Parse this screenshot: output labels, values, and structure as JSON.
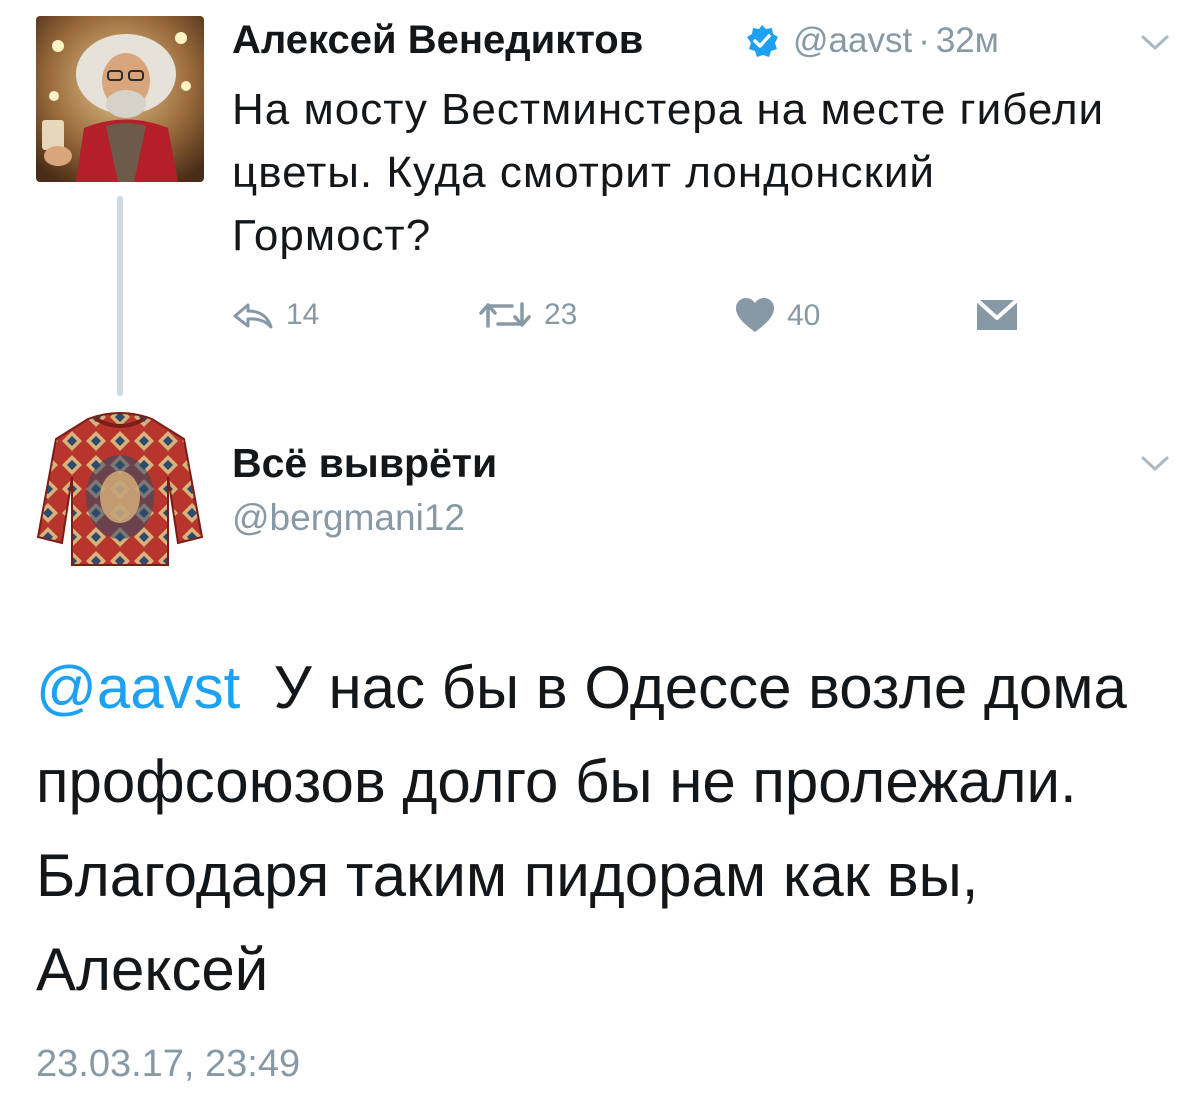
{
  "tweet": {
    "author_name": "Алексей Венедиктов",
    "author_handle": "@aavst",
    "separator": "·",
    "age": "32м",
    "text": "На мосту Вестминстера на месте гибели цветы. Куда смотрит лондонский Гормост?",
    "replies": "14",
    "retweets": "23",
    "likes": "40",
    "verified": true
  },
  "reply": {
    "author_name": "Всё выврёти",
    "author_handle": "@bergmani12",
    "mention": "@aavst",
    "text": "У нас бы в Одессе возле дома профсоюзов долго бы не пролежали. Благодаря таким пидорам как вы, Алексей",
    "timestamp": "23.03.17, 23:49"
  },
  "colors": {
    "link": "#1da1f2",
    "muted": "#8899a6",
    "text": "#14171a",
    "verified": "#1da1f2",
    "thread_line": "#cfd9de"
  },
  "icons": {
    "reply": "reply-icon",
    "retweet": "retweet-icon",
    "like": "heart-icon",
    "dm": "envelope-icon",
    "verified": "verified-badge-icon",
    "menu": "chevron-down-icon"
  }
}
